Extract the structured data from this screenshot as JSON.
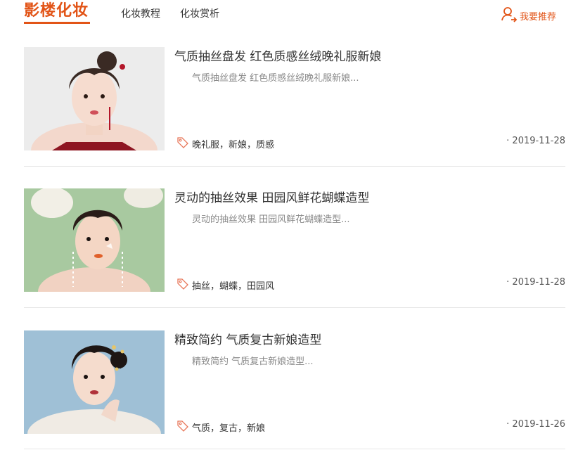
{
  "brand": {
    "logo_text": "影楼化妆",
    "accent": "#e25417"
  },
  "nav": {
    "items": [
      {
        "label": "化妆教程"
      },
      {
        "label": "化妆赏析"
      }
    ]
  },
  "header_right": {
    "recommend_label": "我要推荐",
    "icon": "user-icon"
  },
  "articles": [
    {
      "title": "气质抽丝盘发 红色质感丝绒晚礼服新娘",
      "excerpt": "气质抽丝盘发 红色质感丝绒晚礼服新娘...",
      "tags": "晚礼服，新娘，质感",
      "date": "· 2019-11-28",
      "thumb_bg": "#ececec"
    },
    {
      "title": "灵动的抽丝效果 田园风鲜花蝴蝶造型",
      "excerpt": "灵动的抽丝效果 田园风鲜花蝴蝶造型...",
      "tags": "抽丝，蝴蝶，田园风",
      "date": "· 2019-11-28",
      "thumb_bg": "#a8c9a0"
    },
    {
      "title": "精致简约 气质复古新娘造型",
      "excerpt": "精致简约 气质复古新娘造型...",
      "tags": "气质，复古，新娘",
      "date": "· 2019-11-26",
      "thumb_bg": "#9fc0d6"
    }
  ]
}
